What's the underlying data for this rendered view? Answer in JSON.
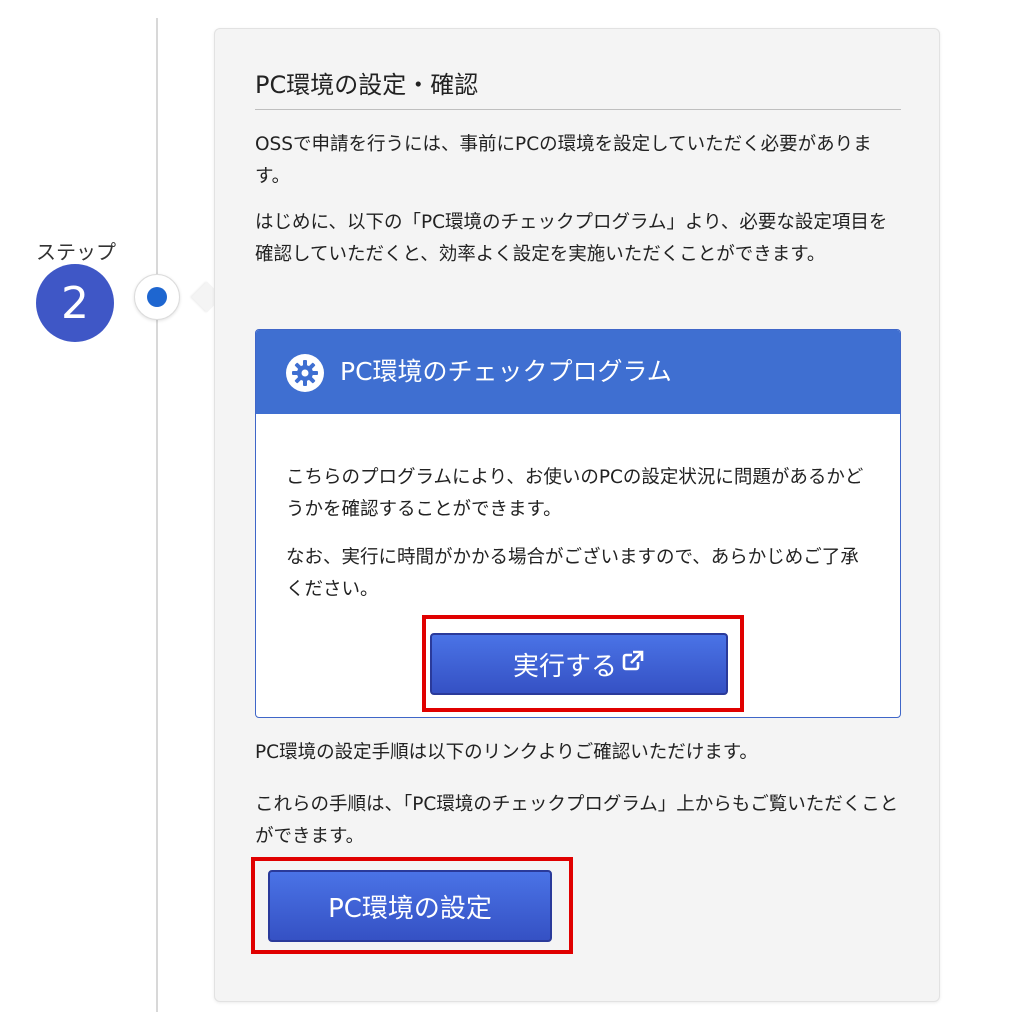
{
  "step": {
    "label": "ステップ",
    "number": "2"
  },
  "card": {
    "title": "PC環境の設定・確認",
    "intro_1": "OSSで申請を行うには、事前にPCの環境を設定していただく必要があります。",
    "intro_2": "はじめに、以下の「PC環境のチェックプログラム」より、必要な設定項目を確認していただくと、効率よく設定を実施いただくことができます。",
    "program": {
      "icon": "gear-icon",
      "title": "PC環境のチェックプログラム",
      "desc_1": "こちらのプログラムにより、お使いのPCの設定状況に問題があるかどうかを確認することができます。",
      "desc_2": "なお、実行に時間がかかる場合がございますので、あらかじめご了承ください。",
      "run_button": "実行する",
      "run_button_icon": "external-link-icon"
    },
    "link_text_1": "PC環境の設定手順は以下のリンクよりご確認いただけます。",
    "link_text_2": "これらの手順は、「PC環境のチェックプログラム」上からもご覧いただくことができます。",
    "settings_button": "PC環境の設定"
  },
  "colors": {
    "accent": "#3f6fd1",
    "step_circle": "#3f57c6",
    "timeline_dot": "#1e66d0",
    "highlight": "#e00000",
    "card_bg": "#f4f4f4"
  }
}
